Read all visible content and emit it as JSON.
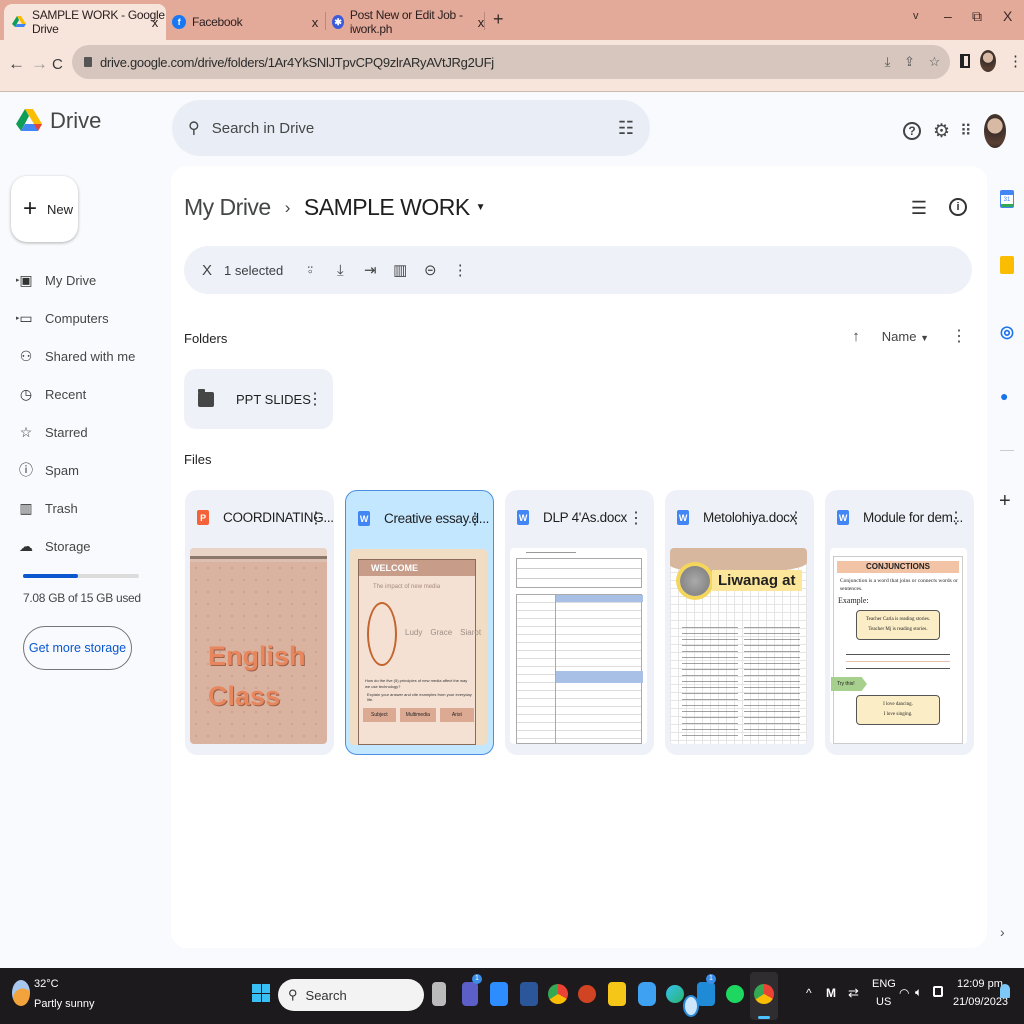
{
  "browser": {
    "tabs": [
      {
        "title": "SAMPLE WORK - Google Drive",
        "icon": "google-drive-icon",
        "active": true
      },
      {
        "title": "Facebook",
        "icon": "facebook-icon",
        "active": false
      },
      {
        "title": "Post New or Edit Job - iwork.ph",
        "icon": "iwork-icon",
        "active": false
      }
    ],
    "close_glyph": "x",
    "new_tab_glyph": "+",
    "window_controls": {
      "dropdown": "v",
      "minimize": "–",
      "restore": "⧉",
      "close": "X"
    },
    "url": "drive.google.com/drive/folders/1Ar4YkSNlJTpvCPQ9zlrARyAVtJRg2UFj",
    "nav": {
      "back": "←",
      "forward": "→",
      "reload": "C"
    }
  },
  "drive": {
    "logo_text": "Drive",
    "search_placeholder": "Search in Drive",
    "new_label": "New",
    "sidebar": [
      {
        "label": "My Drive",
        "icon": "my-drive-icon",
        "glyph": "▣",
        "expandable": true
      },
      {
        "label": "Computers",
        "icon": "computers-icon",
        "glyph": "▭",
        "expandable": true
      },
      {
        "label": "Shared with me",
        "icon": "shared-icon",
        "glyph": "👥",
        "expandable": false
      },
      {
        "label": "Recent",
        "icon": "clock-icon",
        "glyph": "◷",
        "expandable": false
      },
      {
        "label": "Starred",
        "icon": "star-icon",
        "glyph": "☆",
        "expandable": false
      },
      {
        "label": "Spam",
        "icon": "spam-icon",
        "glyph": "ⓘ",
        "expandable": false
      },
      {
        "label": "Trash",
        "icon": "trash-icon",
        "glyph": "🗑",
        "expandable": false
      },
      {
        "label": "Storage",
        "icon": "cloud-icon",
        "glyph": "☁",
        "expandable": false
      }
    ],
    "storage": {
      "used_text": "7.08 GB of 15 GB used",
      "used_fraction": 0.472,
      "button": "Get more storage"
    },
    "breadcrumb": {
      "parent": "My Drive",
      "current": "SAMPLE WORK"
    },
    "selection": {
      "count_label": "1 selected"
    },
    "folders_label": "Folders",
    "files_label": "Files",
    "sort": {
      "label": "Name",
      "direction": "ascending"
    },
    "folders": [
      {
        "name": "PPT SLIDES"
      }
    ],
    "files": [
      {
        "name": "COORDINATING...",
        "type": "powerpoint",
        "badge": "P",
        "color": "#f4623a",
        "selected": false
      },
      {
        "name": "Creative essay.d...",
        "type": "word",
        "badge": "W",
        "color": "#4285f4",
        "selected": true
      },
      {
        "name": "DLP 4'As.docx",
        "type": "word",
        "badge": "W",
        "color": "#4285f4",
        "selected": false
      },
      {
        "name": "Metolohiya.docx",
        "type": "word",
        "badge": "W",
        "color": "#4285f4",
        "selected": false
      },
      {
        "name": "Module for dem...",
        "type": "word",
        "badge": "W",
        "color": "#4285f4",
        "selected": false
      }
    ],
    "thumbs": {
      "english": {
        "line1": "English",
        "line2": "Class"
      },
      "essay": {
        "welcome": "WELCOME",
        "subtitle": "The impact of new media",
        "names": [
          "Ludy",
          "Grace",
          "Siarot"
        ],
        "question": "How do the five (5) principles of new media affect the way we use technology?",
        "prompt": "Explain your answer and cite examples from your everyday life.",
        "buttons": [
          "Subject",
          "Multimedia",
          "Arist"
        ]
      },
      "liwanag": {
        "title": "Liwanag at"
      },
      "module": {
        "heading": "CONJUNCTIONS",
        "definition": "Conjunction is a word that joins or connects words or sentences.",
        "example_label": "Example:",
        "examples": [
          "Teacher Carla is reading stories.",
          "Teacher Mj is reading stories."
        ],
        "try": "Try this!",
        "tries": [
          "I love dancing.",
          "I love singing."
        ]
      }
    }
  },
  "taskbar": {
    "weather_temp": "32°C",
    "weather_desc": "Partly sunny",
    "search_label": "Search",
    "lang1": "ENG",
    "lang2": "US",
    "time": "12:09 pm",
    "date": "21/09/2023",
    "badges": {
      "teams": "1",
      "mail": "1"
    }
  },
  "colors": {
    "accent": "#0b57d0",
    "tabbar": "#e3a999",
    "selected_card": "#c2e7ff"
  }
}
